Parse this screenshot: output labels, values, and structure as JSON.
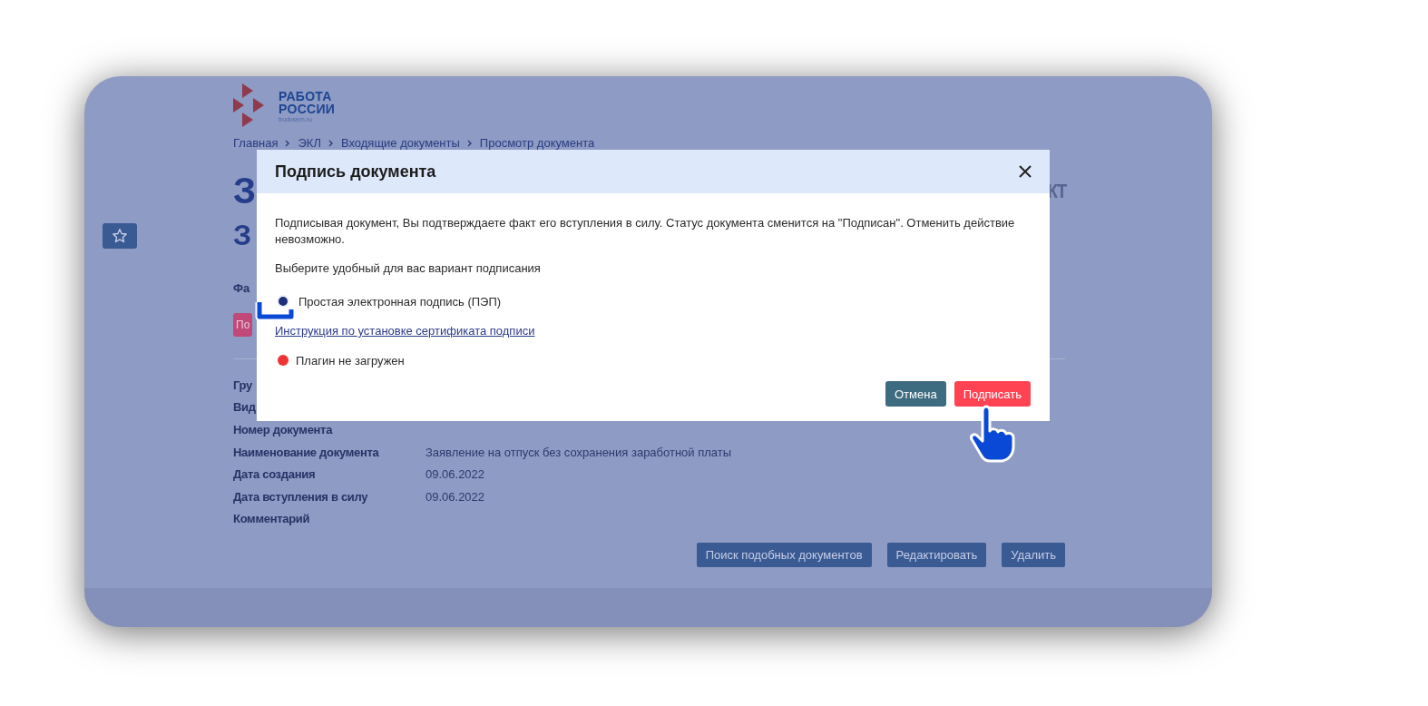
{
  "logo": {
    "line_1": "РАБОТА",
    "line_2": "РОССИИ",
    "domain": "trudvsem.ru"
  },
  "breadcrumbs": [
    "Главная",
    "ЭКЛ",
    "Входящие документы",
    "Просмотр документа"
  ],
  "header": {
    "title_fragment": "З",
    "right_fragment": "КТ",
    "subtitle_fragment": "З",
    "field_fragment": "Фа",
    "button_fragment": "По"
  },
  "details": [
    {
      "label": "Гру"
    },
    {
      "label": "Вид"
    },
    {
      "label": "Номер документа"
    },
    {
      "label": "Наименование документа",
      "value": "Заявление на отпуск без сохранения заработной платы"
    },
    {
      "label": "Дата создания",
      "value": "09.06.2022"
    },
    {
      "label": "Дата вступления в силу",
      "value": "09.06.2022"
    },
    {
      "label": "Комментарий"
    }
  ],
  "actions": [
    "Поиск подобных документов",
    "Редактировать",
    "Удалить"
  ],
  "dialog": {
    "title": "Подпись документа",
    "text": "Подписывая документ, Вы подтверждаете факт его вступления в силу. Статус документа сменится на \"Подписан\". Отменить действие невозможно.",
    "prompt": "Выберите удобный для вас вариант подписания",
    "options": [
      {
        "label": "Простая электронная подпись (ПЭП)",
        "selected": true
      }
    ],
    "link": "Инструкция по установке сертификата подписи",
    "plugin_status": {
      "text": "Плагин не загружен",
      "color": "#ee3434"
    },
    "buttons": [
      {
        "label": "Отмена",
        "kind": "secondary"
      },
      {
        "label": "Подписать",
        "kind": "primary"
      }
    ]
  }
}
